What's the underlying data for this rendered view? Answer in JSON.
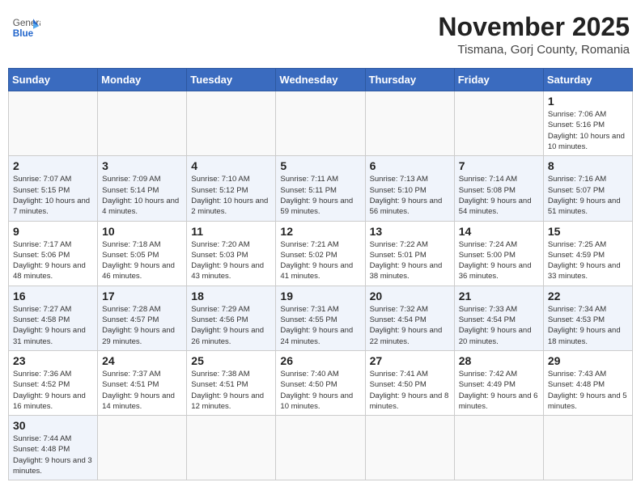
{
  "header": {
    "logo_text_normal": "General",
    "logo_text_bold": "Blue",
    "main_title": "November 2025",
    "subtitle": "Tismana, Gorj County, Romania"
  },
  "calendar": {
    "days_of_week": [
      "Sunday",
      "Monday",
      "Tuesday",
      "Wednesday",
      "Thursday",
      "Friday",
      "Saturday"
    ],
    "weeks": [
      [
        {
          "day": "",
          "info": ""
        },
        {
          "day": "",
          "info": ""
        },
        {
          "day": "",
          "info": ""
        },
        {
          "day": "",
          "info": ""
        },
        {
          "day": "",
          "info": ""
        },
        {
          "day": "",
          "info": ""
        },
        {
          "day": "1",
          "info": "Sunrise: 7:06 AM\nSunset: 5:16 PM\nDaylight: 10 hours and 10 minutes."
        }
      ],
      [
        {
          "day": "2",
          "info": "Sunrise: 7:07 AM\nSunset: 5:15 PM\nDaylight: 10 hours and 7 minutes."
        },
        {
          "day": "3",
          "info": "Sunrise: 7:09 AM\nSunset: 5:14 PM\nDaylight: 10 hours and 4 minutes."
        },
        {
          "day": "4",
          "info": "Sunrise: 7:10 AM\nSunset: 5:12 PM\nDaylight: 10 hours and 2 minutes."
        },
        {
          "day": "5",
          "info": "Sunrise: 7:11 AM\nSunset: 5:11 PM\nDaylight: 9 hours and 59 minutes."
        },
        {
          "day": "6",
          "info": "Sunrise: 7:13 AM\nSunset: 5:10 PM\nDaylight: 9 hours and 56 minutes."
        },
        {
          "day": "7",
          "info": "Sunrise: 7:14 AM\nSunset: 5:08 PM\nDaylight: 9 hours and 54 minutes."
        },
        {
          "day": "8",
          "info": "Sunrise: 7:16 AM\nSunset: 5:07 PM\nDaylight: 9 hours and 51 minutes."
        }
      ],
      [
        {
          "day": "9",
          "info": "Sunrise: 7:17 AM\nSunset: 5:06 PM\nDaylight: 9 hours and 48 minutes."
        },
        {
          "day": "10",
          "info": "Sunrise: 7:18 AM\nSunset: 5:05 PM\nDaylight: 9 hours and 46 minutes."
        },
        {
          "day": "11",
          "info": "Sunrise: 7:20 AM\nSunset: 5:03 PM\nDaylight: 9 hours and 43 minutes."
        },
        {
          "day": "12",
          "info": "Sunrise: 7:21 AM\nSunset: 5:02 PM\nDaylight: 9 hours and 41 minutes."
        },
        {
          "day": "13",
          "info": "Sunrise: 7:22 AM\nSunset: 5:01 PM\nDaylight: 9 hours and 38 minutes."
        },
        {
          "day": "14",
          "info": "Sunrise: 7:24 AM\nSunset: 5:00 PM\nDaylight: 9 hours and 36 minutes."
        },
        {
          "day": "15",
          "info": "Sunrise: 7:25 AM\nSunset: 4:59 PM\nDaylight: 9 hours and 33 minutes."
        }
      ],
      [
        {
          "day": "16",
          "info": "Sunrise: 7:27 AM\nSunset: 4:58 PM\nDaylight: 9 hours and 31 minutes."
        },
        {
          "day": "17",
          "info": "Sunrise: 7:28 AM\nSunset: 4:57 PM\nDaylight: 9 hours and 29 minutes."
        },
        {
          "day": "18",
          "info": "Sunrise: 7:29 AM\nSunset: 4:56 PM\nDaylight: 9 hours and 26 minutes."
        },
        {
          "day": "19",
          "info": "Sunrise: 7:31 AM\nSunset: 4:55 PM\nDaylight: 9 hours and 24 minutes."
        },
        {
          "day": "20",
          "info": "Sunrise: 7:32 AM\nSunset: 4:54 PM\nDaylight: 9 hours and 22 minutes."
        },
        {
          "day": "21",
          "info": "Sunrise: 7:33 AM\nSunset: 4:54 PM\nDaylight: 9 hours and 20 minutes."
        },
        {
          "day": "22",
          "info": "Sunrise: 7:34 AM\nSunset: 4:53 PM\nDaylight: 9 hours and 18 minutes."
        }
      ],
      [
        {
          "day": "23",
          "info": "Sunrise: 7:36 AM\nSunset: 4:52 PM\nDaylight: 9 hours and 16 minutes."
        },
        {
          "day": "24",
          "info": "Sunrise: 7:37 AM\nSunset: 4:51 PM\nDaylight: 9 hours and 14 minutes."
        },
        {
          "day": "25",
          "info": "Sunrise: 7:38 AM\nSunset: 4:51 PM\nDaylight: 9 hours and 12 minutes."
        },
        {
          "day": "26",
          "info": "Sunrise: 7:40 AM\nSunset: 4:50 PM\nDaylight: 9 hours and 10 minutes."
        },
        {
          "day": "27",
          "info": "Sunrise: 7:41 AM\nSunset: 4:50 PM\nDaylight: 9 hours and 8 minutes."
        },
        {
          "day": "28",
          "info": "Sunrise: 7:42 AM\nSunset: 4:49 PM\nDaylight: 9 hours and 6 minutes."
        },
        {
          "day": "29",
          "info": "Sunrise: 7:43 AM\nSunset: 4:48 PM\nDaylight: 9 hours and 5 minutes."
        }
      ],
      [
        {
          "day": "30",
          "info": "Sunrise: 7:44 AM\nSunset: 4:48 PM\nDaylight: 9 hours and 3 minutes."
        },
        {
          "day": "",
          "info": ""
        },
        {
          "day": "",
          "info": ""
        },
        {
          "day": "",
          "info": ""
        },
        {
          "day": "",
          "info": ""
        },
        {
          "day": "",
          "info": ""
        },
        {
          "day": "",
          "info": ""
        }
      ]
    ]
  }
}
